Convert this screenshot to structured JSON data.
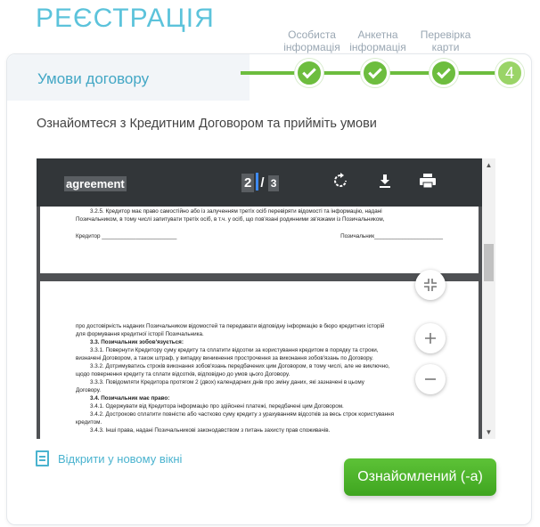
{
  "page": {
    "title": "РЕЄСТРАЦІЯ"
  },
  "stepper": {
    "current_step_title": "Умови договору",
    "steps": [
      {
        "label_line1": "Особиста",
        "label_line2": "інформація"
      },
      {
        "label_line1": "Анкетна",
        "label_line2": "інформація"
      },
      {
        "label_line1": "Перевірка",
        "label_line2": "карти"
      },
      {
        "number": "4"
      }
    ],
    "colors": {
      "done": "#6dbd3e",
      "current": "#9ad467"
    }
  },
  "instruction": "Ознайомтеся з Кредитним Договором та прийміть умови",
  "viewer": {
    "doc_name": "agreement",
    "page_current": "2",
    "page_separator": "/",
    "page_total": "3",
    "icons": {
      "rotate": "rotate-icon",
      "download": "download-icon",
      "print": "print-icon"
    },
    "page1": {
      "line1": "3.2.5. Кредитор має право самостійно або із залученням третіх осіб перевіряти відомості та інформацію, надані",
      "line2": "Позичальником, в тому числі запитувати третіх осіб, в т.ч. у осіб, що пов'язані родинними зв'язками із Позичальником,",
      "creditor": "Кредитор ________________________",
      "borrower": "Позичальник______________________"
    },
    "page2": {
      "l1": "про достовірність наданих Позичальником відомостей та передавати відповідну інформацію в бюро кредитних історій",
      "l2": "для формування кредитної історії Позичальника.",
      "l3": "3.3. Позичальник зобов'язується:",
      "l4": "3.3.1. Повернути Кредитору суму кредиту та сплатити відсотки за користування кредитом в порядку та строки,",
      "l5": "визначені Договором, а також штраф, у випадку виникнення прострочення за виконання зобов'язань по Договору.",
      "l6": "3.3.2. Дотримуватись строків виконання зобов'язань передбачених цим Договором, в тому числі, але не виключно,",
      "l7": "щодо повернення кредиту та сплати відсотків, відповідно до умов цього Договору.",
      "l8": "3.3.3. Повідомляти Кредитора протягом 2 (двох) календарних днів про зміну даних, які зазначені в цьому",
      "l9": "Договору.",
      "l10": "3.4. Позичальник має право:",
      "l11": "3.4.1. Одержувати від Кредитора інформацію про здійснені платежі, передбачені цим Договором.",
      "l12": "3.4.2. Достроково сплатити повністю або частково суму кредиту з урахуванням відсотків за весь строк користування",
      "l13": "кредитом.",
      "l14": "3.4.3. Інші права, надані Позичальникові законодавством з питань захисту прав споживачів."
    }
  },
  "open_new_window": "Відкрити у новому вікні",
  "agree_button": "Ознайомлений (-а)"
}
